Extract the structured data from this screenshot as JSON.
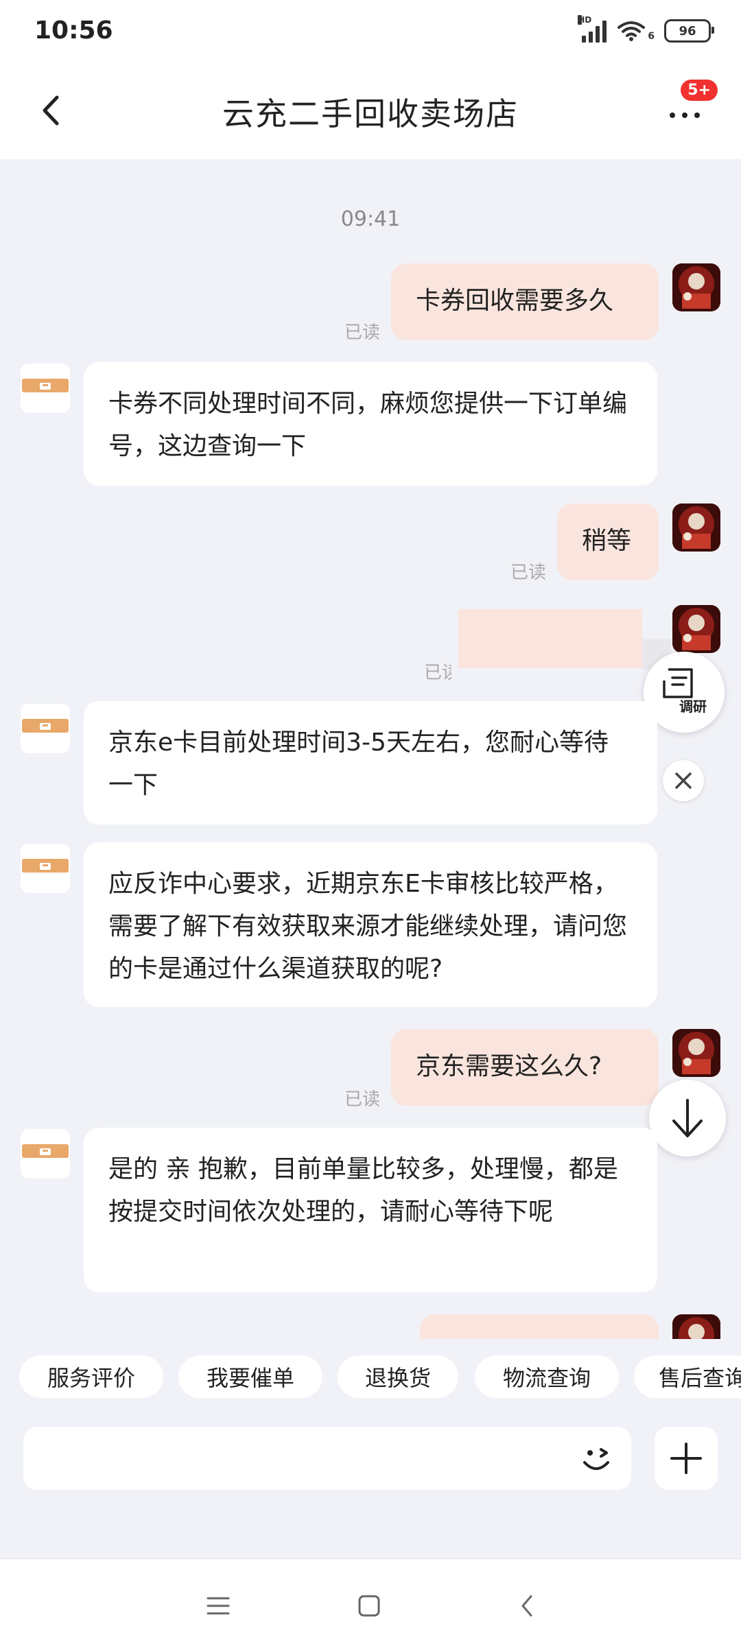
{
  "status_bar": {
    "time": "10:56",
    "network": "HD",
    "wifi_level": "6",
    "battery": "96"
  },
  "header": {
    "title": "云充二手回收卖场店",
    "badge": "5+"
  },
  "chat": {
    "timestamp": "09:41",
    "read_label": "已读",
    "partial_read_label": "已读",
    "messages": [
      {
        "side": "out",
        "text": "卡券回收需要多久"
      },
      {
        "side": "in",
        "text": "卡券不同处理时间不同，麻烦您提供一下订单编号，这边查询一下"
      },
      {
        "side": "out",
        "text": "稍等"
      },
      {
        "side": "in",
        "text": "京东e卡目前处理时间3-5天左右，您耐心等待一下"
      },
      {
        "side": "in",
        "text": "应反诈中心要求，近期京东E卡审核比较严格，需要了解下有效获取来源才能继续处理，请问您的卡是通过什么渠道获取的呢?"
      },
      {
        "side": "out",
        "text": "京东需要这么久?"
      },
      {
        "side": "in",
        "text": "是的 亲 抱歉，目前单量比较多，处理慢，都是按提交时间依次处理的，请耐心等待下呢"
      }
    ]
  },
  "floating": {
    "survey_label": "调研"
  },
  "quick_actions": [
    "服务评价",
    "我要催单",
    "退换货",
    "物流查询",
    "售后查询"
  ],
  "icons": {
    "back": "chevron-left-icon",
    "more": "more-dots-icon",
    "survey": "survey-icon",
    "close": "close-icon",
    "scroll_down": "arrow-down-icon",
    "emoji": "emoji-icon",
    "plus": "plus-icon",
    "nav_menu": "menu-icon",
    "nav_home": "home-square-icon",
    "nav_back": "nav-back-icon"
  },
  "colors": {
    "accent_badge": "#f0312f",
    "bubble_out": "#fae5de",
    "bubble_in": "#ffffff",
    "background": "#f1f2f7"
  }
}
